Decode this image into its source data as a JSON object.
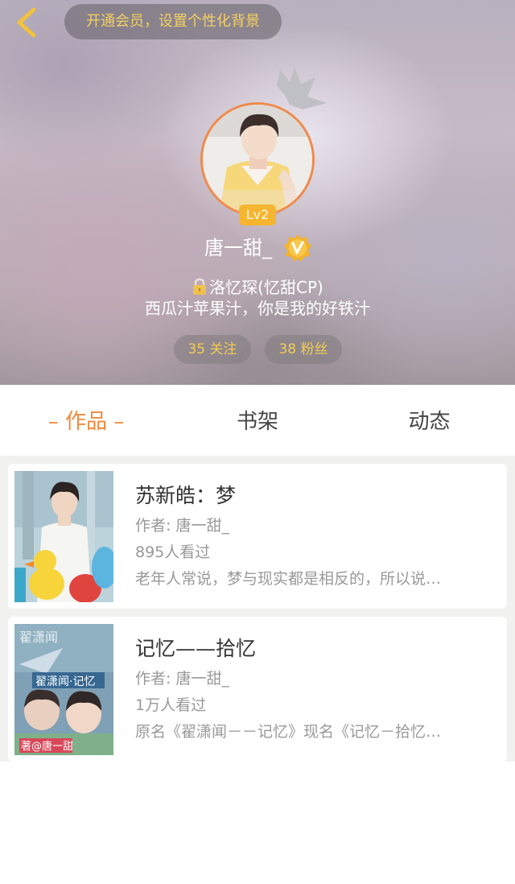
{
  "header": {
    "vip_banner": "开通会员，设置个性化背景",
    "level": "Lv2",
    "username": "唐一甜_",
    "cp_line": "洛忆琛(忆甜CP)",
    "bio": "西瓜汁苹果汁，你是我的好铁汁",
    "follow": "35 关注",
    "fans": "38 粉丝",
    "accent_color": "#ef8a3c",
    "stat_text_color": "#f3cb55"
  },
  "tabs": [
    {
      "label": "– 作品 –",
      "active": true
    },
    {
      "label": "书架",
      "active": false
    },
    {
      "label": "动态",
      "active": false
    }
  ],
  "works": [
    {
      "title": "苏新皓：梦",
      "author": "作者: 唐一甜_",
      "views": "895人看过",
      "desc": "老年人常说，梦与现实都是相反的，所以说…"
    },
    {
      "title": "记忆——拾忆",
      "author": "作者: 唐一甜_",
      "views": "1万人看过",
      "desc": "原名《翟潇闻－－记忆》现名《记忆－拾忆…",
      "cover_text_top": "翟潇闻",
      "cover_text_mid": "翟潇闻·记忆",
      "cover_text_bottom": "著@唐一甜"
    }
  ]
}
